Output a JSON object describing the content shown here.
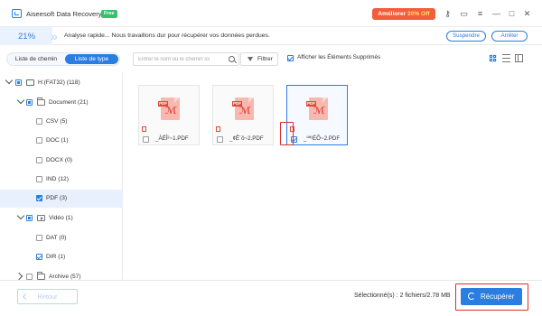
{
  "app": {
    "title": "Aiseesoft Data Recovery",
    "badge": "Free",
    "upgrade_label": "Améliorer",
    "upgrade_discount": "20% Off"
  },
  "titlebar_icons": [
    "key-icon",
    "chat-icon",
    "menu-icon",
    "minimize-icon",
    "maximize-icon",
    "close-icon"
  ],
  "scan": {
    "percent": "21%",
    "status": "Analyse rapide... Nous travaillons dur pour récupérer vos données perdues.",
    "pause_label": "Suspendre",
    "stop_label": "Arrêter"
  },
  "tabs": {
    "path_label": "Liste de chemin",
    "type_label": "Liste de type",
    "active": "type"
  },
  "search": {
    "placeholder": "Entrer le nom ou le chemin ici",
    "value": ""
  },
  "filter_label": "Filtrer",
  "show_deleted_label": "Afficher les Éléments Supprimés",
  "tree": [
    {
      "label": "H:(FAT32) (118)",
      "level": 0,
      "icon": "drive-icon",
      "expander": "open",
      "check": "partial"
    },
    {
      "label": "Document (21)",
      "level": 1,
      "icon": "folder-icon",
      "expander": "open",
      "check": "partial"
    },
    {
      "label": "CSV (5)",
      "level": 2,
      "icon": "",
      "expander": "",
      "check": "none"
    },
    {
      "label": "DOC (1)",
      "level": 2,
      "icon": "",
      "expander": "",
      "check": "none"
    },
    {
      "label": "DOCX (0)",
      "level": 2,
      "icon": "",
      "expander": "",
      "check": "none"
    },
    {
      "label": "IND (12)",
      "level": 2,
      "icon": "",
      "expander": "",
      "check": "none"
    },
    {
      "label": "PDF (3)",
      "level": 2,
      "icon": "",
      "expander": "",
      "check": "filled",
      "selected": true
    },
    {
      "label": "Vidéo (1)",
      "level": 1,
      "icon": "video-icon",
      "expander": "open",
      "check": "partial"
    },
    {
      "label": "DAT (0)",
      "level": 2,
      "icon": "",
      "expander": "",
      "check": "none"
    },
    {
      "label": "DIR (1)",
      "level": 2,
      "icon": "",
      "expander": "",
      "check": "checked"
    },
    {
      "label": "Archive (57)",
      "level": 1,
      "icon": "folder-icon",
      "expander": "closed",
      "check": "none"
    }
  ],
  "files": [
    {
      "name": "_ÀÉÎ²~1.PDF",
      "checked": false,
      "selected": false
    },
    {
      "name": "_¢Ê´ô~2.PDF",
      "checked": false,
      "selected": false
    },
    {
      "name": "_ºª¹ÉÕ~2.PDF",
      "checked": true,
      "selected": true
    }
  ],
  "footer": {
    "back_label": "Retour",
    "selection_summary": "Sélectionné(s) : 2 fichiers/2.78 MB",
    "recover_label": "Récupérer"
  },
  "colors": {
    "accent": "#2a7de1",
    "upgrade": "#f25d3c",
    "free_badge": "#37c16a",
    "pdf_red": "#e04a3f",
    "highlight": "#d9302c"
  }
}
